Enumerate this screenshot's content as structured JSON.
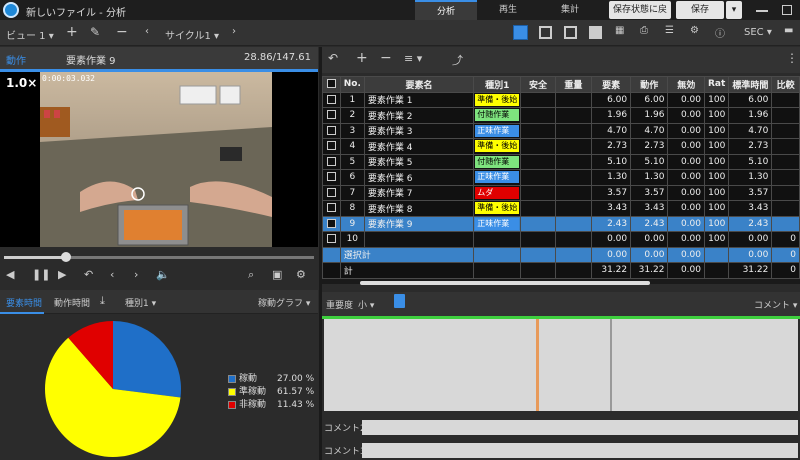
{
  "window": {
    "title": "新しいファイル - 分析",
    "tabs": [
      "分析",
      "再生",
      "集計"
    ],
    "restore_label": "保存状態に戻す",
    "save_label": "保存"
  },
  "toolbar": {
    "view_label": "ビュー 1",
    "cycle_label": "サイクル1",
    "unit_label": "SEC"
  },
  "player": {
    "header_title": "動作",
    "element_name": "要素作業 9",
    "time_readout": "28.86/147.61",
    "speed": "1.0×",
    "timestamp": "0:00:03.032",
    "progress": 0.2
  },
  "bottom_left": {
    "tabs": [
      "要素時間",
      "動作時間",
      "種別1",
      "稼動グラフ"
    ]
  },
  "pie": {
    "slices": [
      {
        "label": "稼動",
        "percent_text": "27.00 %",
        "value": 27.0,
        "color": "#1f6fc8"
      },
      {
        "label": "準稼動",
        "percent_text": "61.57 %",
        "value": 61.57,
        "color": "#ffff00"
      },
      {
        "label": "非稼動",
        "percent_text": "11.43 %",
        "value": 11.43,
        "color": "#e00000"
      }
    ]
  },
  "table": {
    "columns": [
      "No.",
      "要素名",
      "種別1",
      "安全",
      "重量",
      "要素",
      "動作",
      "無効",
      "Rat",
      "標準時間",
      "比較"
    ],
    "rows": [
      {
        "no": "1",
        "name": "要素作業 1",
        "type": "準備・後始",
        "type_color": "#ffff00",
        "elem": "6.00",
        "act": "6.00",
        "inv": "0.00",
        "rat": "100",
        "std": "6.00",
        "cmp": ""
      },
      {
        "no": "2",
        "name": "要素作業 2",
        "type": "付随作業",
        "type_color": "#7ee37e",
        "elem": "1.96",
        "act": "1.96",
        "inv": "0.00",
        "rat": "100",
        "std": "1.96",
        "cmp": ""
      },
      {
        "no": "3",
        "name": "要素作業 3",
        "type": "正味作業",
        "type_color": "#3a8ee6",
        "elem": "4.70",
        "act": "4.70",
        "inv": "0.00",
        "rat": "100",
        "std": "4.70",
        "cmp": ""
      },
      {
        "no": "4",
        "name": "要素作業 4",
        "type": "準備・後始",
        "type_color": "#ffff00",
        "elem": "2.73",
        "act": "2.73",
        "inv": "0.00",
        "rat": "100",
        "std": "2.73",
        "cmp": ""
      },
      {
        "no": "5",
        "name": "要素作業 5",
        "type": "付随作業",
        "type_color": "#7ee37e",
        "elem": "5.10",
        "act": "5.10",
        "inv": "0.00",
        "rat": "100",
        "std": "5.10",
        "cmp": ""
      },
      {
        "no": "6",
        "name": "要素作業 6",
        "type": "正味作業",
        "type_color": "#3a8ee6",
        "elem": "1.30",
        "act": "1.30",
        "inv": "0.00",
        "rat": "100",
        "std": "1.30",
        "cmp": ""
      },
      {
        "no": "7",
        "name": "要素作業 7",
        "type": "ムダ",
        "type_color": "#e00000",
        "elem": "3.57",
        "act": "3.57",
        "inv": "0.00",
        "rat": "100",
        "std": "3.57",
        "cmp": ""
      },
      {
        "no": "8",
        "name": "要素作業 8",
        "type": "準備・後始",
        "type_color": "#ffff00",
        "elem": "3.43",
        "act": "3.43",
        "inv": "0.00",
        "rat": "100",
        "std": "3.43",
        "cmp": ""
      },
      {
        "no": "9",
        "name": "要素作業 9",
        "type": "正味作業",
        "type_color": "#3a8ee6",
        "elem": "2.43",
        "act": "2.43",
        "inv": "0.00",
        "rat": "100",
        "std": "2.43",
        "cmp": "",
        "selected": true
      },
      {
        "no": "10",
        "name": "",
        "type": "",
        "type_color": "",
        "elem": "0.00",
        "act": "0.00",
        "inv": "0.00",
        "rat": "100",
        "std": "0.00",
        "cmp": "0"
      }
    ],
    "subtotal": {
      "label": "選択計",
      "elem": "0.00",
      "act": "0.00",
      "inv": "0.00",
      "std": "0.00",
      "cmp": "0"
    },
    "total": {
      "label": "計",
      "elem": "31.22",
      "act": "31.22",
      "inv": "0.00",
      "std": "31.22",
      "cmp": "0"
    }
  },
  "timeline": {
    "importance_label": "重要度",
    "importance_value": "小",
    "comment_menu": "コメント",
    "comment2_label": "コメント2",
    "comment3_label": "コメント3"
  },
  "colors": {
    "accent": "#3a8ee6",
    "selection": "#3a82c8",
    "timeline_green": "#3ecf3e"
  }
}
